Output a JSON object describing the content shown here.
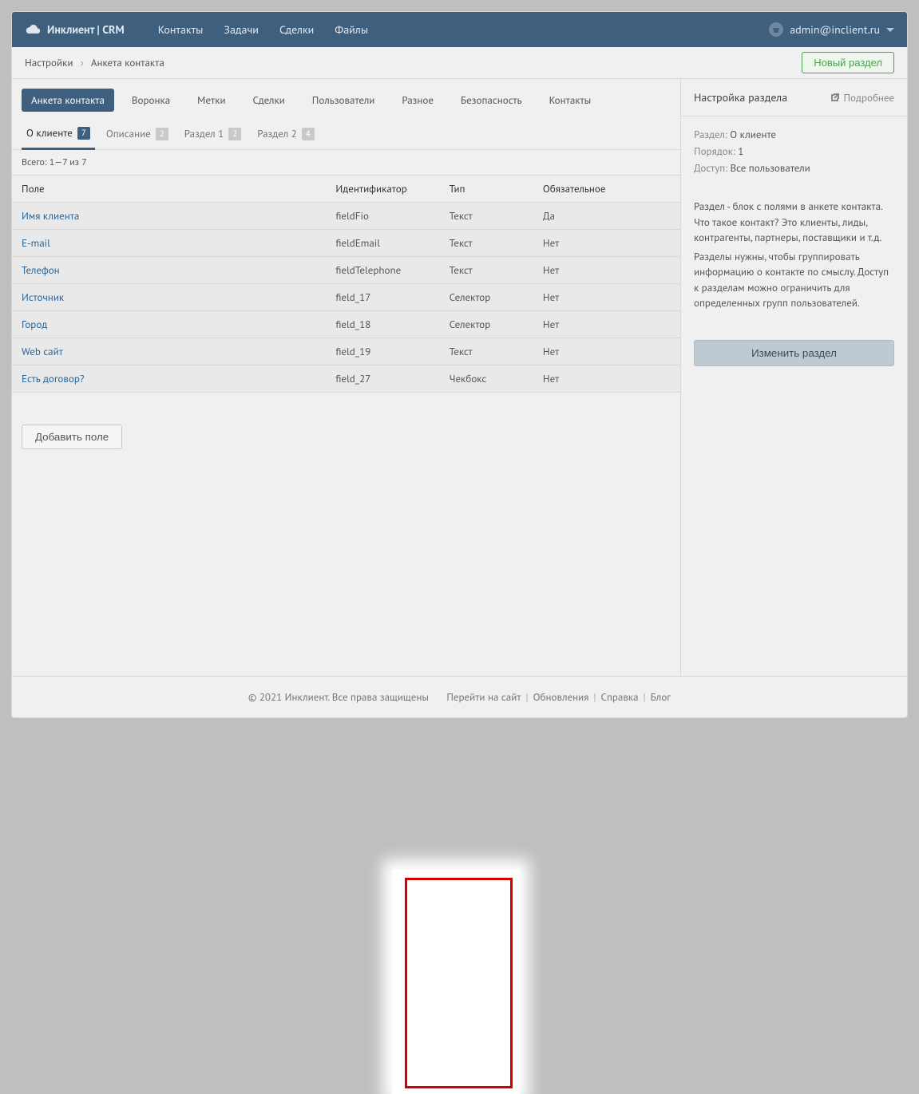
{
  "brand": "Инклиент | CRM",
  "topnav": [
    "Контакты",
    "Задачи",
    "Сделки",
    "Файлы"
  ],
  "user": "admin@inclient.ru",
  "crumb": {
    "root": "Настройки",
    "current": "Анкета контакта"
  },
  "new_section_btn": "Новый раздел",
  "tabs": [
    "Анкета контакта",
    "Воронка",
    "Метки",
    "Сделки",
    "Пользователи",
    "Разное",
    "Безопасность",
    "Контакты"
  ],
  "active_tab": 0,
  "subtabs": [
    {
      "label": "О клиенте",
      "count": "7",
      "active": true
    },
    {
      "label": "Описание",
      "count": "2"
    },
    {
      "label": "Раздел 1",
      "count": "2"
    },
    {
      "label": "Раздел 2",
      "count": "4"
    }
  ],
  "count_line": "Всего: 1—7 из 7",
  "columns": {
    "field": "Поле",
    "id": "Идентификатор",
    "type": "Тип",
    "req": "Обязательное"
  },
  "rows": [
    {
      "field": "Имя клиента",
      "id": "fieldFio",
      "type": "Текст",
      "req": "Да"
    },
    {
      "field": "E-mail",
      "id": "fieldEmail",
      "type": "Текст",
      "req": "Нет"
    },
    {
      "field": "Телефон",
      "id": "fieldTelephone",
      "type": "Текст",
      "req": "Нет"
    },
    {
      "field": "Источник",
      "id": "field_17",
      "type": "Селектор",
      "req": "Нет"
    },
    {
      "field": "Город",
      "id": "field_18",
      "type": "Селектор",
      "req": "Нет"
    },
    {
      "field": "Web сайт",
      "id": "field_19",
      "type": "Текст",
      "req": "Нет"
    },
    {
      "field": "Есть договор?",
      "id": "field_27",
      "type": "Чекбокс",
      "req": "Нет"
    }
  ],
  "add_field_btn": "Добавить поле",
  "side": {
    "title": "Настройка раздела",
    "more": "Подробнее",
    "section_k": "Раздел:",
    "section_v": "О клиенте",
    "order_k": "Порядок:",
    "order_v": "1",
    "access_k": "Доступ:",
    "access_v": "Все пользователи",
    "desc1": "Раздел - блок с полями в анкете контакта. Что такое контакт? Это клиенты, лиды, контрагенты, партнеры, поставщики и т.д.",
    "desc2": "Разделы нужны, чтобы группировать информацию о контакте по смыслу. Доступ к разделам можно ограничить для определенных групп пользователей.",
    "edit_btn": "Изменить раздел"
  },
  "footer": {
    "copy": "© 2021 Инклиент. Все права защищены",
    "links": [
      "Перейти на сайт",
      "Обновления",
      "Справка",
      "Блог"
    ]
  }
}
